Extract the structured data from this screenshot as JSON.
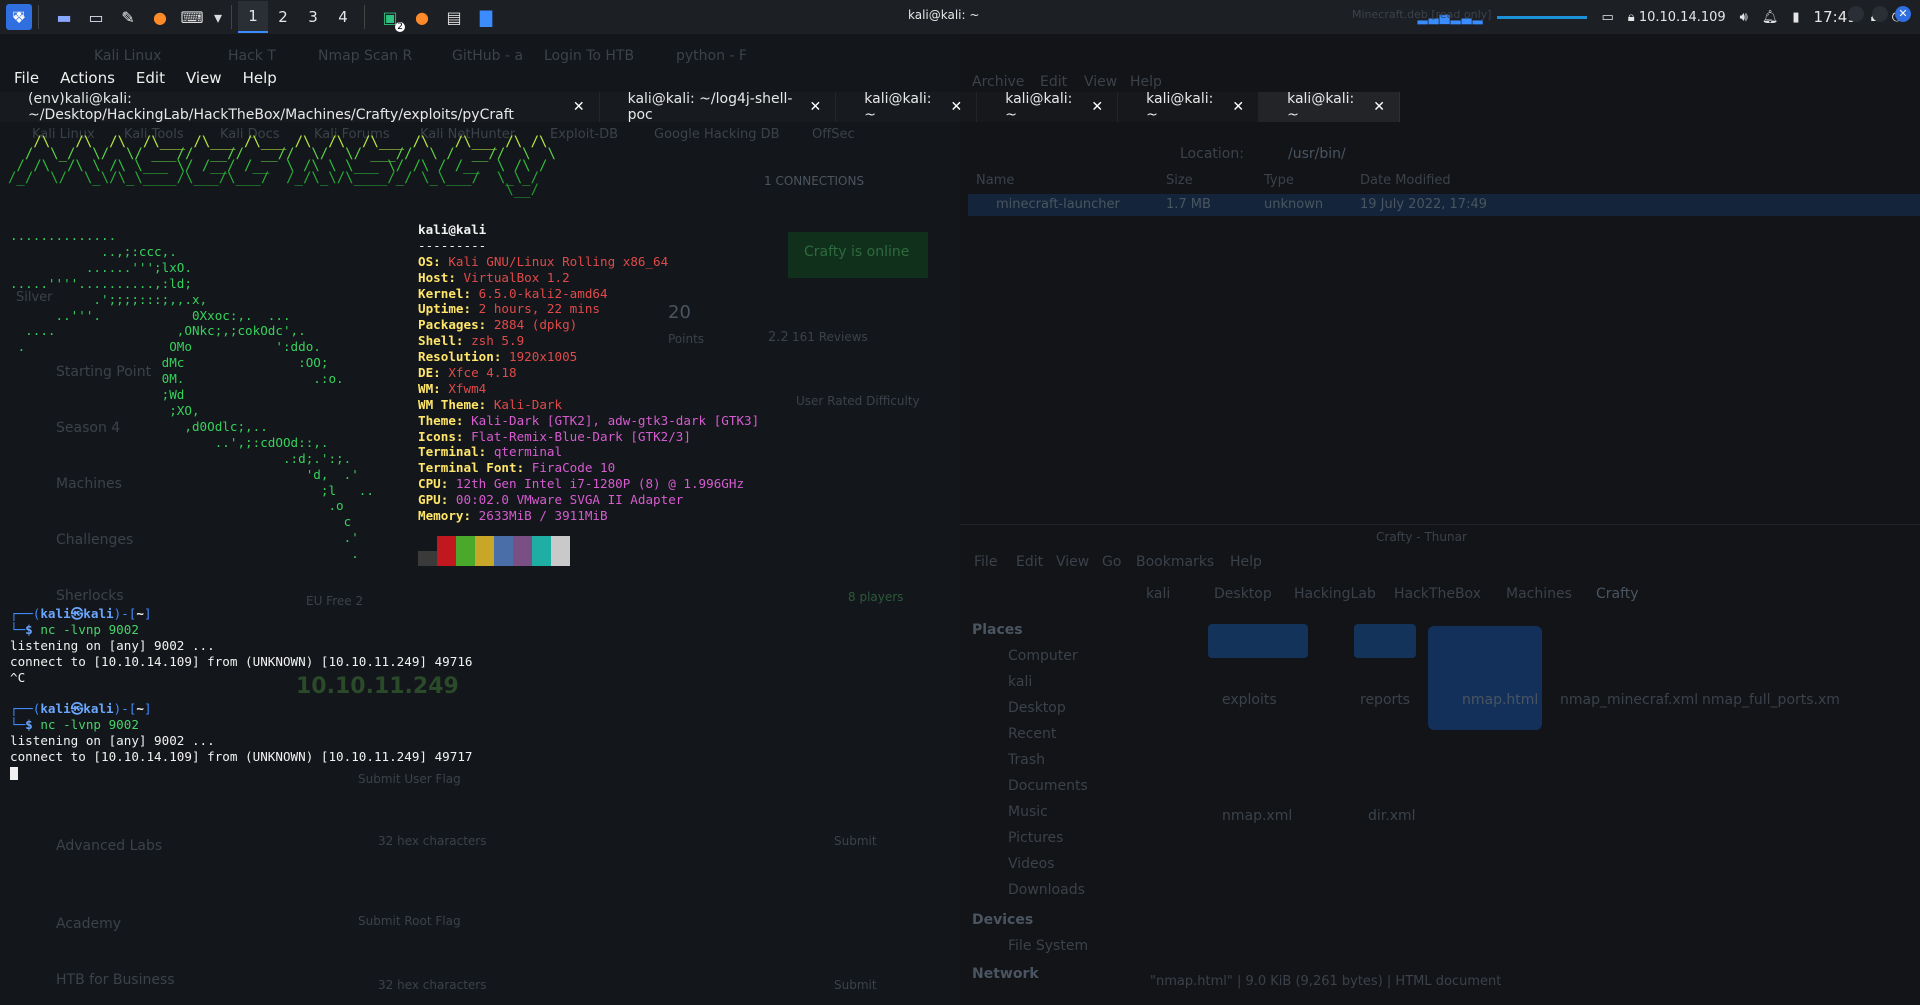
{
  "panel": {
    "workspaces": [
      "1",
      "2",
      "3",
      "4"
    ],
    "ip": "10.10.14.109",
    "clock": "17:49",
    "badge": "2"
  },
  "window": {
    "title": "kali@kali: ~",
    "right_title": "Minecraft.deb [read only]"
  },
  "menu": [
    "File",
    "Actions",
    "Edit",
    "View",
    "Help"
  ],
  "tabs": [
    {
      "label": "(env)kali@kali: ~/Desktop/HackingLab/HackTheBox/Machines/Crafty/exploits/pyCraft",
      "active": false
    },
    {
      "label": "kali@kali: ~/log4j-shell-poc",
      "active": false
    },
    {
      "label": "kali@kali: ~",
      "active": false
    },
    {
      "label": "kali@kali: ~",
      "active": false
    },
    {
      "label": "kali@kali: ~",
      "active": false
    },
    {
      "label": "kali@kali: ~",
      "active": true
    }
  ],
  "browser_ghost": {
    "tabs": [
      "Kali Linux",
      "Hack T",
      "Nmap Scan R",
      "GitHub - a",
      "Login To HTB",
      "python - F"
    ],
    "bookmarks": [
      "Kali Linux",
      "Kali Tools",
      "Kali Docs",
      "Kali Forums",
      "Kali NetHunter",
      "Exploit-DB",
      "Google Hacking DB",
      "OffSec"
    ],
    "connections": "1 CONNECTIONS",
    "online": "Crafty is online",
    "points": "20",
    "points_label": "Points",
    "rating": "2.2",
    "reviews": "161 Reviews",
    "difficulty": "User Rated Difficulty",
    "nav": [
      "Starting Point",
      "Season 4",
      "Machines",
      "Challenges",
      "Sherlocks",
      "Advanced Labs",
      "Academy",
      "HTB for Business"
    ],
    "rank": "Silver",
    "ip": "10.10.11.249",
    "server": "EU Free 2",
    "players": "8 players",
    "user_flag": "Submit User Flag",
    "root_flag": "Submit Root Flag",
    "hex": "32 hex characters",
    "submit": "Submit"
  },
  "archive_ghost": {
    "menu": [
      "Archive",
      "Edit",
      "View",
      "Help"
    ],
    "location_label": "Location:",
    "location": "/usr/bin/",
    "columns": [
      "Name",
      "Size",
      "Type",
      "Date Modified"
    ],
    "row": [
      "minecraft-launcher",
      "1.7 MB",
      "unknown",
      "19 July 2022, 17:49"
    ]
  },
  "thunar_ghost": {
    "title": "Crafty - Thunar",
    "menu": [
      "File",
      "Edit",
      "View",
      "Go",
      "Bookmarks",
      "Help"
    ],
    "crumbs": [
      "kali",
      "Desktop",
      "HackingLab",
      "HackTheBox",
      "Machines",
      "Crafty"
    ],
    "places_label": "Places",
    "places": [
      "Computer",
      "kali",
      "Desktop",
      "Recent",
      "Trash",
      "Documents",
      "Music",
      "Pictures",
      "Videos",
      "Downloads"
    ],
    "devices_label": "Devices",
    "devices": [
      "File System"
    ],
    "network_label": "Network",
    "files": [
      "exploits",
      "reports",
      "nmap.html",
      "nmap_minecraf.xml",
      "nmap_full_ports.xm",
      "nmap.xml",
      "dir.xml"
    ],
    "status": "\"nmap.html\" | 9.0 KiB (9,261 bytes) | HTML document"
  },
  "neofetch": {
    "user": "kali@kali",
    "divider": "---------",
    "fields": [
      {
        "k": "OS",
        "v": "Kali GNU/Linux Rolling x86_64"
      },
      {
        "k": "Host",
        "v": "VirtualBox 1.2"
      },
      {
        "k": "Kernel",
        "v": "6.5.0-kali2-amd64"
      },
      {
        "k": "Uptime",
        "v": "2 hours, 22 mins"
      },
      {
        "k": "Packages",
        "v": "2884 (dpkg)"
      },
      {
        "k": "Shell",
        "v": "zsh 5.9"
      },
      {
        "k": "Resolution",
        "v": "1920x1005"
      },
      {
        "k": "DE",
        "v": "Xfce 4.18"
      },
      {
        "k": "WM",
        "v": "Xfwm4"
      },
      {
        "k": "WM Theme",
        "v": "Kali-Dark"
      },
      {
        "k": "Theme",
        "v": "Kali-Dark [GTK2], adw-gtk3-dark [GTK3]"
      },
      {
        "k": "Icons",
        "v": "Flat-Remix-Blue-Dark [GTK2/3]"
      },
      {
        "k": "Terminal",
        "v": "qterminal"
      },
      {
        "k": "Terminal Font",
        "v": "FiraCode 10"
      },
      {
        "k": "CPU",
        "v": "12th Gen Intel i7-1280P (8) @ 1.996GHz"
      },
      {
        "k": "GPU",
        "v": "00:02.0 VMware SVGA II Adapter"
      },
      {
        "k": "Memory",
        "v": "2633MiB / 3911MiB"
      }
    ],
    "palette": [
      "#3a3a3a",
      "#c0181e",
      "#4aa82a",
      "#c7a628",
      "#4a6fa8",
      "#7a4f83",
      "#1faea4",
      "#c9c9c9"
    ]
  },
  "session1": {
    "prompt_user": "kali",
    "prompt_host": "kali",
    "prompt_dir": "~",
    "command": "nc -lvnp 9002",
    "output": [
      "listening on [any] 9002 ...",
      "connect to [10.10.14.109] from (UNKNOWN) [10.10.11.249] 49716",
      "^C"
    ]
  },
  "session2": {
    "prompt_user": "kali",
    "prompt_host": "kali",
    "prompt_dir": "~",
    "command": "nc -lvnp 9002",
    "output": [
      "listening on [any] 9002 ...",
      "connect to [10.10.14.109] from (UNKNOWN) [10.10.11.249] 49717"
    ]
  }
}
